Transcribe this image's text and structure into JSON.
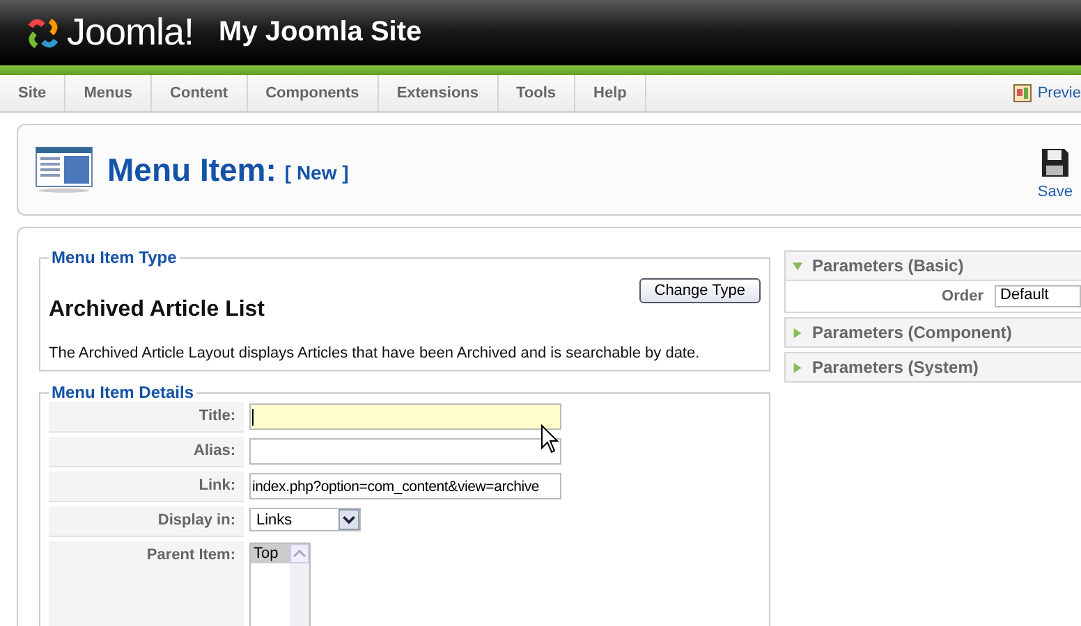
{
  "header": {
    "logo_text": "Joomla!",
    "site_name": "My Joomla Site"
  },
  "menu": [
    {
      "label": "Site"
    },
    {
      "label": "Menus"
    },
    {
      "label": "Content"
    },
    {
      "label": "Components"
    },
    {
      "label": "Extensions"
    },
    {
      "label": "Tools"
    },
    {
      "label": "Help"
    }
  ],
  "preview": {
    "label": "Previe"
  },
  "toolbar": {
    "title": "Menu Item:",
    "subtitle": "[ New ]",
    "buttons": [
      {
        "label": "Save"
      }
    ]
  },
  "menu_item_type": {
    "legend": "Menu Item Type",
    "name": "Archived Article List",
    "button": "Change Type",
    "description": "The Archived Article Layout displays Articles that have been Archived and is searchable by date."
  },
  "details": {
    "legend": "Menu Item Details",
    "fields": [
      {
        "kind": "text",
        "label": "Title:",
        "focused": true
      },
      {
        "kind": "text",
        "label": "Alias:",
        "focused": false
      },
      {
        "kind": "text",
        "label": "Link:",
        "value": "index.php?option=com_content&view=archive",
        "focused": false
      },
      {
        "kind": "select",
        "label": "Display in:",
        "value": "Links"
      },
      {
        "kind": "list",
        "label": "Parent Item:",
        "options": [
          {
            "label": "Top",
            "selected": true
          }
        ]
      }
    ]
  },
  "params": [
    {
      "title": "Parameters (Basic)",
      "expanded": true,
      "rows": [
        {
          "label": "Order",
          "value": "Default"
        }
      ]
    },
    {
      "title": "Parameters (Component)",
      "expanded": false
    },
    {
      "title": "Parameters (System)",
      "expanded": false
    }
  ]
}
